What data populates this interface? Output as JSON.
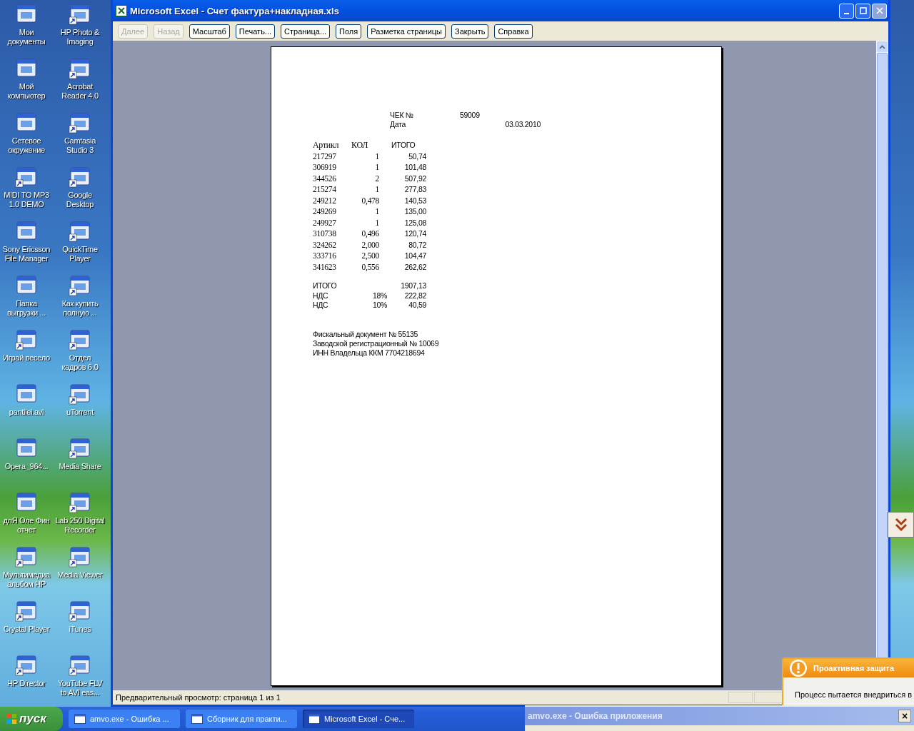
{
  "desktop_icons": [
    {
      "lines": [
        "Мои",
        "документы"
      ],
      "shortcut": false
    },
    {
      "lines": [
        "HP Photo &",
        "Imaging"
      ],
      "shortcut": true
    },
    {
      "lines": [
        "Мой",
        "компьютер"
      ],
      "shortcut": false
    },
    {
      "lines": [
        "Acrobat",
        "Reader 4.0"
      ],
      "shortcut": true
    },
    {
      "lines": [
        "Сетевое",
        "окружение"
      ],
      "shortcut": false
    },
    {
      "lines": [
        "Camtasia",
        "Studio 3"
      ],
      "shortcut": true
    },
    {
      "lines": [
        "MIDI TO MP3",
        "1.0 DEMO"
      ],
      "shortcut": true
    },
    {
      "lines": [
        "Google",
        "Desktop"
      ],
      "shortcut": true
    },
    {
      "lines": [
        "Sony Ericsson",
        "File Manager"
      ],
      "shortcut": false
    },
    {
      "lines": [
        "QuickTime",
        "Player"
      ],
      "shortcut": true
    },
    {
      "lines": [
        "Папка",
        "выгрузки ..."
      ],
      "shortcut": false
    },
    {
      "lines": [
        "Как купить",
        "полную ..."
      ],
      "shortcut": true
    },
    {
      "lines": [
        "Играй весело"
      ],
      "shortcut": true
    },
    {
      "lines": [
        "Отдел",
        "кадров 6.0"
      ],
      "shortcut": true
    },
    {
      "lines": [
        "pantilei.avi"
      ],
      "shortcut": false
    },
    {
      "lines": [
        "uTorrent"
      ],
      "shortcut": true
    },
    {
      "lines": [
        "Opera_964..."
      ],
      "shortcut": false
    },
    {
      "lines": [
        "Media Share"
      ],
      "shortcut": true
    },
    {
      "lines": [
        "длЯ Оле Фин",
        "отчет"
      ],
      "shortcut": false
    },
    {
      "lines": [
        "Lab 250 Digital",
        "Recorder"
      ],
      "shortcut": true
    },
    {
      "lines": [
        "Мультимедиа",
        "альбом HP"
      ],
      "shortcut": true
    },
    {
      "lines": [
        "Media Viewer"
      ],
      "shortcut": true
    },
    {
      "lines": [
        "Crystal Player"
      ],
      "shortcut": true
    },
    {
      "lines": [
        "iTunes"
      ],
      "shortcut": true
    },
    {
      "lines": [
        "HP Director"
      ],
      "shortcut": true
    },
    {
      "lines": [
        "YouTube FLV",
        "to AVI eas..."
      ],
      "shortcut": true
    }
  ],
  "window": {
    "title": "Microsoft Excel - Счет фактура+накладная.xls",
    "toolbar": [
      {
        "label": "Далее",
        "disabled": true
      },
      {
        "label": "Назад",
        "disabled": true
      },
      {
        "label": "Масштаб",
        "disabled": false
      },
      {
        "label": "Печать...",
        "disabled": false
      },
      {
        "label": "Страница...",
        "disabled": false
      },
      {
        "label": "Поля",
        "disabled": false
      },
      {
        "label": "Разметка страницы",
        "disabled": false
      },
      {
        "label": "Закрыть",
        "disabled": false
      },
      {
        "label": "Справка",
        "disabled": false
      }
    ],
    "page": {
      "header": [
        {
          "label": "ЧЕК №",
          "value": "59009"
        },
        {
          "label": "Дата",
          "value": "03.03.2010"
        }
      ],
      "columns": [
        "Артикл",
        "КОЛ",
        "ИТОГО"
      ],
      "rows": [
        [
          "217297",
          "1",
          "50,74"
        ],
        [
          "306919",
          "1",
          "101,48"
        ],
        [
          "344526",
          "2",
          "507,92"
        ],
        [
          "215274",
          "1",
          "277,83"
        ],
        [
          "249212",
          "0,478",
          "140,53"
        ],
        [
          "249269",
          "1",
          "135,00"
        ],
        [
          "249927",
          "1",
          "125,08"
        ],
        [
          "310738",
          "0,496",
          "120,74"
        ],
        [
          "324262",
          "2,000",
          "80,72"
        ],
        [
          "333716",
          "2,500",
          "104,47"
        ],
        [
          "341623",
          "0,556",
          "262,62"
        ]
      ],
      "summary": [
        {
          "label": "ИТОГО",
          "value": "1907,13"
        },
        {
          "label": "НДС",
          "rate": "18%",
          "value": "222,82"
        },
        {
          "label": "НДС",
          "rate": "10%",
          "value": "40,59"
        }
      ],
      "footer": [
        "Фискальный документ № 55135",
        "Заводской регистрационный № 10069",
        "ИНН Владельца ККМ 7704218694"
      ]
    },
    "status_bar": "Предварительный просмотр: страница 1 из 1"
  },
  "popup": {
    "title": "Проактивная защита",
    "text": "Процесс пытается внедриться в"
  },
  "error_dialog": {
    "title": "amvo.exe - Ошибка приложения",
    "close": "×"
  },
  "taskbar": {
    "start": "пуск",
    "tasks": [
      {
        "label": "amvo.exe - Ошибка ...",
        "selected": false
      },
      {
        "label": "Сборник для практи...",
        "selected": false
      },
      {
        "label": "Microsoft Excel - Сче...",
        "selected": true
      }
    ]
  }
}
